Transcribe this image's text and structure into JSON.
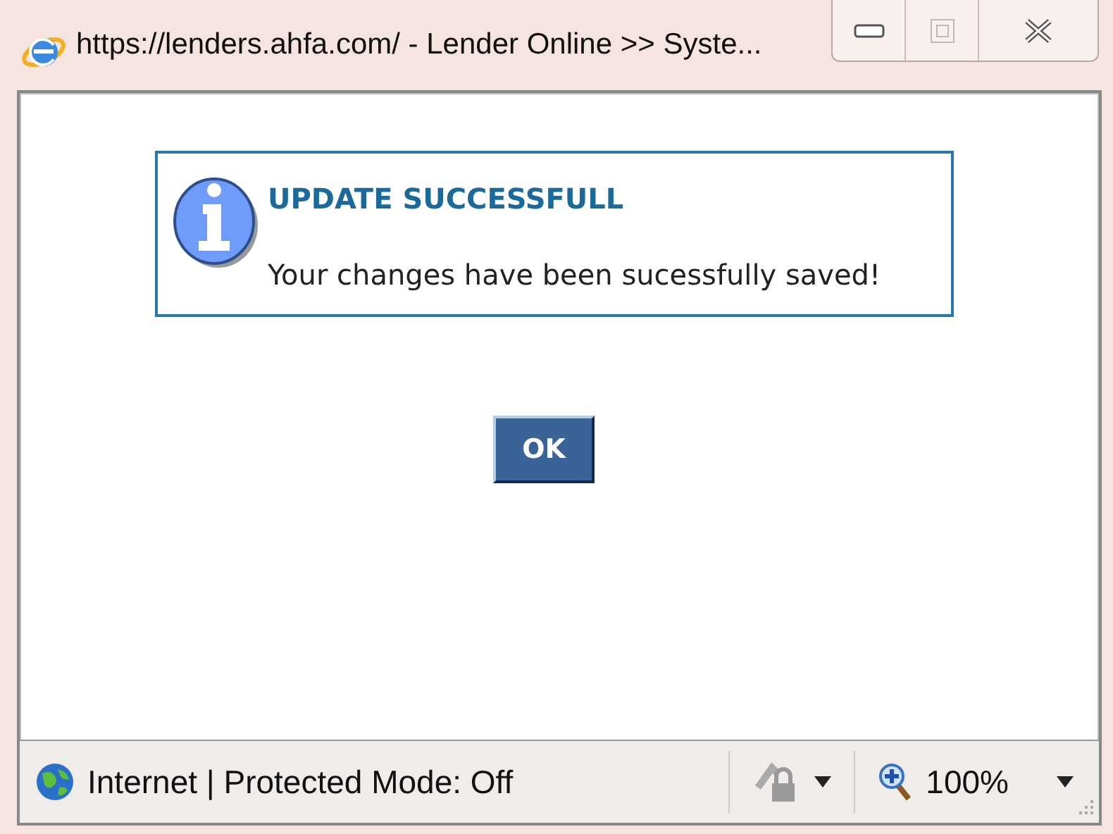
{
  "window": {
    "title": "https://lenders.ahfa.com/ - Lender Online >> Syste..."
  },
  "message": {
    "heading": "UPDATE SUCCESSFULL",
    "text": "Your changes have been sucessfully saved!"
  },
  "buttons": [
    "OK"
  ],
  "status_bar": {
    "zone": "Internet | Protected Mode: Off",
    "zoom": "100%"
  }
}
